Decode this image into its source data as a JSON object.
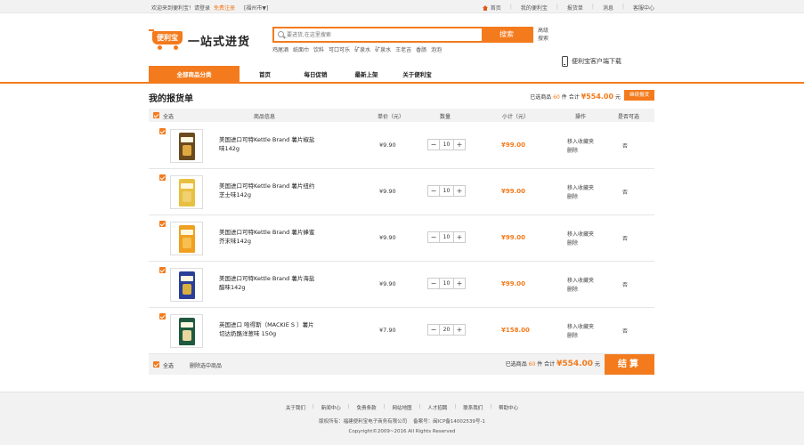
{
  "topbar": {
    "welcome": "欢迎来到便利宝！请登录",
    "register": "免费注册",
    "city": "[福州市▼]",
    "links": [
      "首页",
      "我的便利宝",
      "报货单",
      "消息",
      "客服中心"
    ]
  },
  "header": {
    "logo_text": "便利宝",
    "slogan": "一站式进货",
    "search_placeholder": "要进货,在这里搜索",
    "search_button": "搜索",
    "advanced_1": "高级",
    "advanced_2": "搜索",
    "hotwords": [
      "鸡尾酒",
      "纸面巾",
      "饮料",
      "可口可乐",
      "矿泉水",
      "矿泉水",
      "王老吉",
      "香肠",
      "泡泡"
    ],
    "app_download": "便利宝客户端下载"
  },
  "nav": {
    "all_categories": "全部商品分类",
    "items": [
      "首页",
      "每日促销",
      "最新上架",
      "关于便利宝"
    ]
  },
  "cart": {
    "title": "我的报货单",
    "selected_prefix": "已选商品",
    "selected_count": "60",
    "selected_unit": "件 合计",
    "total": "¥554.00",
    "total_suffix": "元",
    "continue_button": "继续报货",
    "headers": {
      "select_all": "全选",
      "product": "商品信息",
      "unit_price": "单价（元）",
      "quantity": "数量",
      "subtotal": "小计（元）",
      "ops": "操作",
      "available": "是否可选"
    },
    "items": [
      {
        "name": "美国进口可特Kettle Brand 薯片椒盐味142g",
        "price": "¥9.90",
        "qty": "10",
        "subtotal": "¥99.00",
        "op1": "移入收藏夹",
        "op2": "删除",
        "available": "否",
        "bag_color": "#6b4a1e",
        "win_color": "#e0a840"
      },
      {
        "name": "美国进口可特Kettle Brand 薯片纽约芝士味142g",
        "price": "¥9.90",
        "qty": "10",
        "subtotal": "¥99.00",
        "op1": "移入收藏夹",
        "op2": "删除",
        "available": "否",
        "bag_color": "#e8c040",
        "win_color": "#f0d070"
      },
      {
        "name": "美国进口可特Kettle Brand 薯片蜂蜜芥末味142g",
        "price": "¥9.90",
        "qty": "10",
        "subtotal": "¥99.00",
        "op1": "移入收藏夹",
        "op2": "删除",
        "available": "否",
        "bag_color": "#f0a020",
        "win_color": "#f7c050"
      },
      {
        "name": "美国进口可特Kettle Brand 薯片海盐醋味142g",
        "price": "¥9.90",
        "qty": "10",
        "subtotal": "¥99.00",
        "op1": "移入收藏夹",
        "op2": "删除",
        "available": "否",
        "bag_color": "#2a3f9a",
        "win_color": "#d8b040"
      },
      {
        "name": "英国进口 哈得斯（MACKIE S ）薯片 切达奶酪洋葱味 150g",
        "price": "¥7.90",
        "qty": "20",
        "subtotal": "¥158.00",
        "op1": "移入收藏夹",
        "op2": "删除",
        "available": "否",
        "bag_color": "#1f5a3e",
        "win_color": "#e8d8a0"
      }
    ],
    "footer": {
      "select_all": "全选",
      "delete_selected": "删除选中商品",
      "selected_prefix": "已选商品",
      "selected_count": "60",
      "selected_unit": "件 合计",
      "total": "¥554.00",
      "total_suffix": "元",
      "checkout": "结算"
    }
  },
  "site_footer": {
    "links": [
      "关于我们",
      "新闻中心",
      "免责条款",
      "网站地图",
      "人才招聘",
      "联系我们",
      "帮助中心"
    ],
    "company": "版权所有：福建便利宝电子商务有限公司",
    "icp": "备案号：闽ICP备14002539号-1",
    "copyright": "Copyright©2009~2016 All Rights Reserved"
  },
  "colors": {
    "accent": "#f37b1d"
  }
}
